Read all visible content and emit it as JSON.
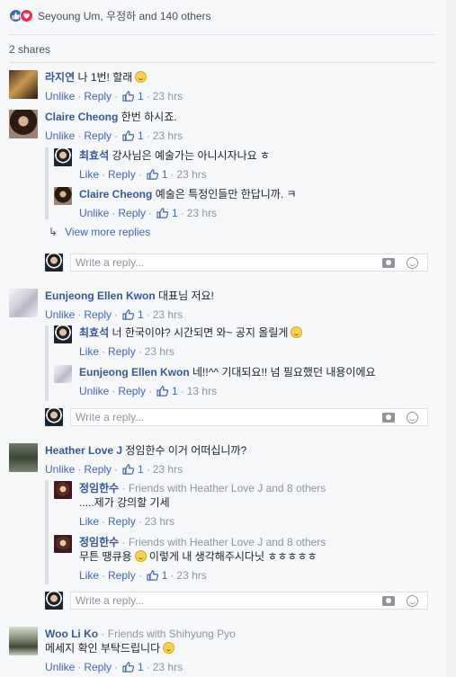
{
  "reactions": {
    "text": "Seyoung Um, 우정하 and 140 others",
    "like_color": "#4267b2",
    "love_color": "#f0284a"
  },
  "shares": "2 shares",
  "labels": {
    "unlike": "Unlike",
    "like": "Like",
    "reply": "Reply",
    "dot": "·",
    "placeholder": "Write a reply...",
    "view_more": "View more replies"
  },
  "comments": [
    {
      "author": "라지연",
      "text": "나 1번! 할래",
      "smile": true,
      "liked": true,
      "likes": "1",
      "time": "23 hrs"
    },
    {
      "author": "Claire Cheong",
      "text": "한번 하시죠.",
      "liked": true,
      "likes": "1",
      "time": "23 hrs",
      "replies": [
        {
          "author": "최효석",
          "text": "강사님은 예술가는 아니시자나요 ㅎ",
          "liked": false,
          "likes": "1",
          "time": "23 hrs"
        },
        {
          "author": "Claire Cheong",
          "text": "예술은 특정인들만 한답니까. ㅋ",
          "liked": true,
          "likes": "1",
          "time": "23 hrs"
        }
      ]
    },
    {
      "author": "Eunjeong Ellen Kwon",
      "text": "대표님 저요!",
      "liked": true,
      "likes": "1",
      "time": "23 hrs",
      "replies": [
        {
          "author": "최효석",
          "text": "너 한국이야? 시간되면 와~ 공지 올릴게",
          "smile": true,
          "liked": false,
          "time": "23 hrs"
        },
        {
          "author": "Eunjeong Ellen Kwon",
          "text": "네!!^^ 기대되요!! 넘 필요했던 내용이에요",
          "liked": true,
          "likes": "1",
          "time": "13 hrs"
        }
      ]
    },
    {
      "author": "Heather Love J",
      "text": "정임한수 이거 어떠십니까?",
      "liked": true,
      "likes": "1",
      "time": "23 hrs",
      "replies": [
        {
          "author": "정임한수",
          "friends": "· Friends with Heather Love J and 8 others",
          "text": ".....제가 강의할 기세",
          "liked": false,
          "time": "23 hrs"
        },
        {
          "author": "정임한수",
          "friends": "· Friends with Heather Love J and 8 others",
          "text": "무튼 땡큐용",
          "smile": true,
          "text2": "이렇게 내 생각해주시다닛 ㅎㅎㅎㅎㅎ",
          "liked": false,
          "likes": "1",
          "time": "23 hrs"
        }
      ]
    },
    {
      "author": "Woo Li Ko",
      "friends": "· Friends with Shihyung Pyo",
      "text": "메세지 확인 부탁드립니다",
      "smile": true,
      "liked": true,
      "likes": "1",
      "time": "23 hrs"
    }
  ]
}
